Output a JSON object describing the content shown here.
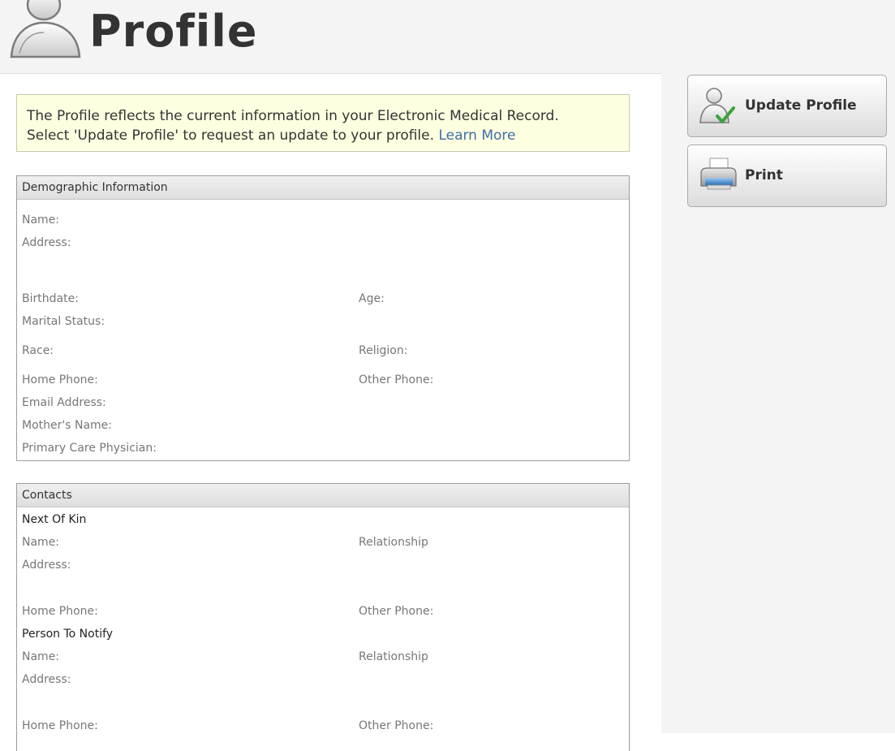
{
  "header": {
    "title": "Profile"
  },
  "notice": {
    "line1": "The Profile reflects the current information in your Electronic Medical Record.",
    "line2": "Select 'Update Profile' to request an update to your profile.",
    "link": "Learn More"
  },
  "actions": {
    "update_label": "Update Profile",
    "print_label": "Print"
  },
  "demographic": {
    "title": "Demographic Information",
    "name": "Name:",
    "address": "Address:",
    "birthdate": "Birthdate:",
    "age": "Age:",
    "marital_status": "Marital Status:",
    "race": "Race:",
    "religion": "Religion:",
    "home_phone": "Home Phone:",
    "other_phone": "Other Phone:",
    "email": "Email Address:",
    "mothers_name": "Mother's Name:",
    "pcp": "Primary Care Physician:"
  },
  "contacts": {
    "title": "Contacts",
    "next_of_kin": {
      "heading": "Next Of Kin",
      "name": "Name:",
      "relationship": "Relationship",
      "address": "Address:",
      "home_phone": "Home Phone:",
      "other_phone": "Other Phone:"
    },
    "person_to_notify": {
      "heading": "Person To Notify",
      "name": "Name:",
      "relationship": "Relationship",
      "address": "Address:",
      "home_phone": "Home Phone:",
      "other_phone": "Other Phone:"
    }
  }
}
